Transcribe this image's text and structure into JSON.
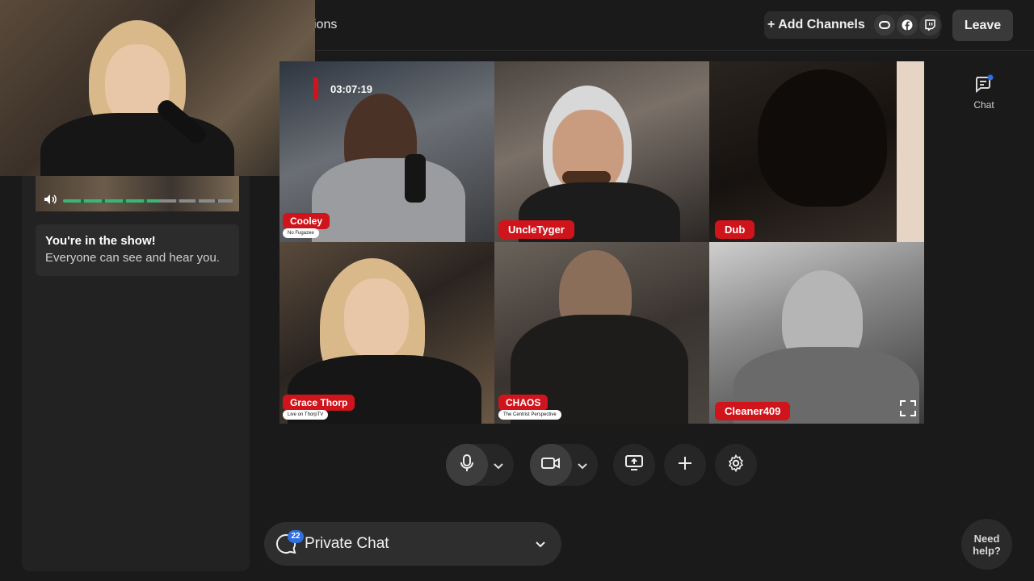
{
  "header": {
    "title_partial": "ions",
    "add_channels_label": "+ Add Channels",
    "leave_label": "Leave"
  },
  "side_panel": {
    "chat_label": "Chat"
  },
  "left_panel": {
    "show_title": "You're in the show!",
    "show_subtitle": "Everyone can see and hear you."
  },
  "stage": {
    "timer": "03:07:19",
    "participants": [
      {
        "name": "Cooley",
        "subtitle": "No Fugazee"
      },
      {
        "name": "UncleTyger",
        "subtitle": ""
      },
      {
        "name": "Dub",
        "subtitle": ""
      },
      {
        "name": "Grace Thorp",
        "subtitle": "Live on ThorpTV"
      },
      {
        "name": "CHAOS",
        "subtitle": "The Centrist Perspective"
      },
      {
        "name": "Cleaner409",
        "subtitle": ""
      }
    ]
  },
  "controls": {
    "private_chat_label": "Private Chat",
    "private_chat_count": "22",
    "need_help_label": "Need help?"
  },
  "colors": {
    "accent_red": "#d0141b",
    "badge_blue": "#2f6fe0",
    "level_green": "#3ab575"
  }
}
